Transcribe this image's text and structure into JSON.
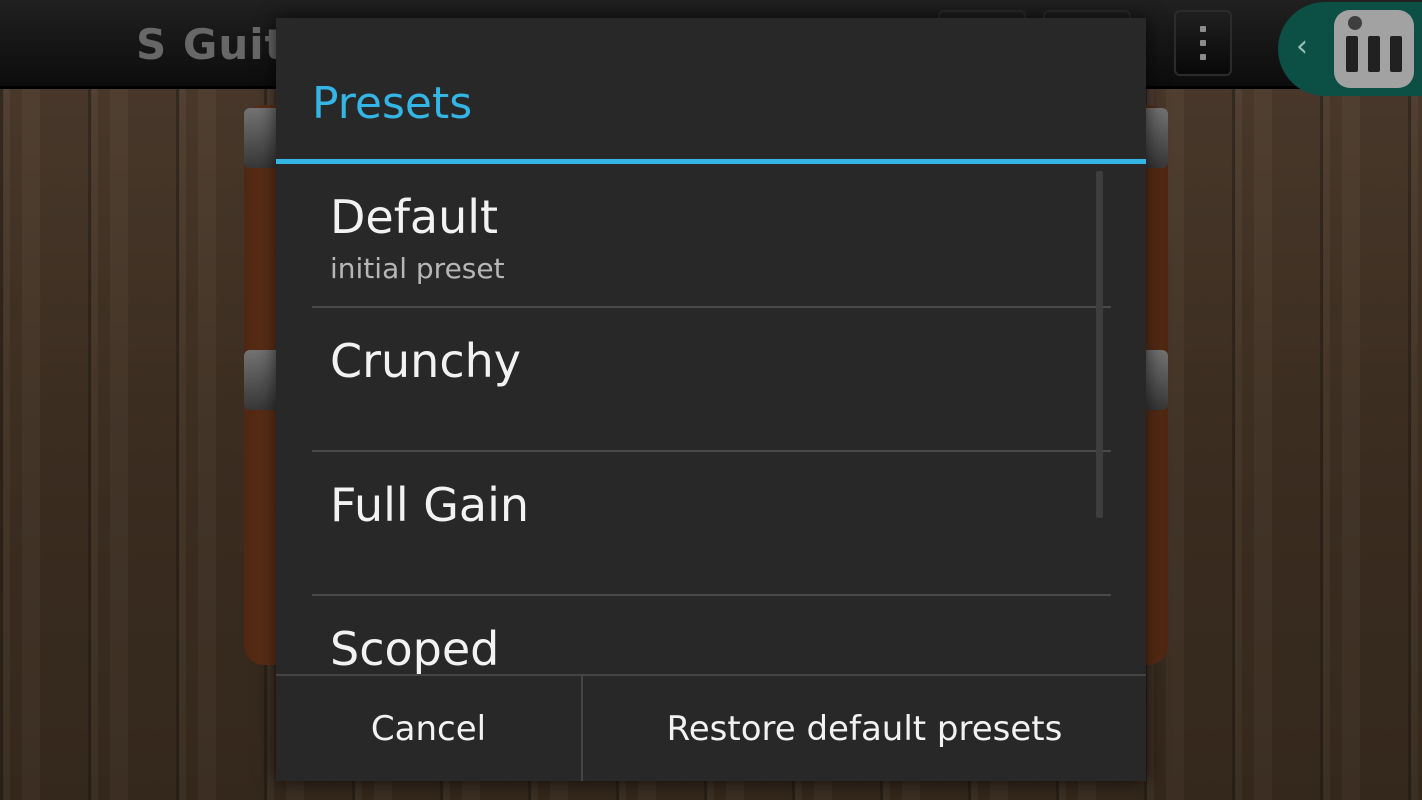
{
  "app": {
    "title": "S Guit"
  },
  "dialog": {
    "title": "Presets",
    "accent_color": "#33b5e5",
    "presets": [
      {
        "name": "Default",
        "subtitle": "initial preset"
      },
      {
        "name": "Crunchy",
        "subtitle": ""
      },
      {
        "name": "Full Gain",
        "subtitle": ""
      },
      {
        "name": "Scoped",
        "subtitle": ""
      }
    ],
    "buttons": {
      "cancel_label": "Cancel",
      "restore_label": "Restore default presets"
    }
  },
  "icons": {
    "overflow_menu": "more-vert-icon",
    "side_launcher_chevron": "chevron-left-icon",
    "side_launcher_app": "piano-app-icon"
  }
}
